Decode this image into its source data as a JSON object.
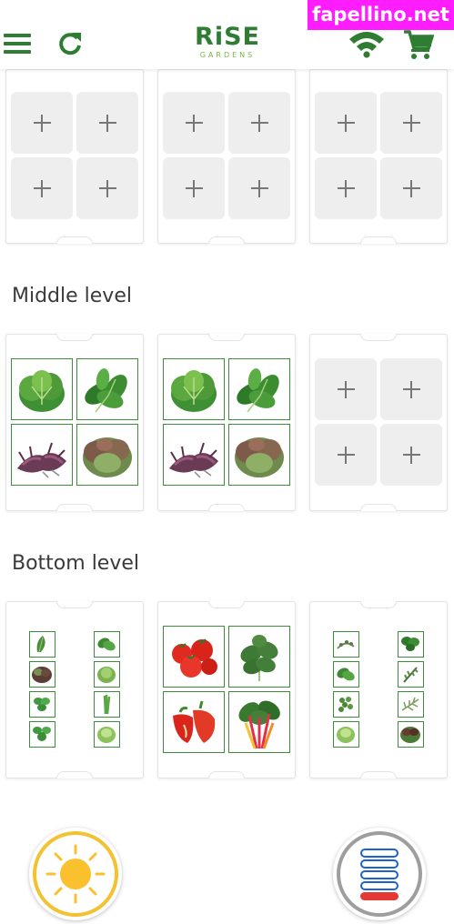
{
  "header": {
    "logo_main": "RiSE",
    "logo_sub": "GARDENS",
    "icons": [
      "menu-icon",
      "refresh-icon",
      "wifi-icon",
      "cart-icon"
    ],
    "brand_color": "#2e7d32"
  },
  "watermark": "fapellino.net",
  "levels": [
    {
      "label": "",
      "trays": [
        {
          "layout": "grid4",
          "cells": [
            "empty",
            "empty",
            "empty",
            "empty"
          ]
        },
        {
          "layout": "grid4",
          "cells": [
            "empty",
            "empty",
            "empty",
            "empty"
          ]
        },
        {
          "layout": "grid4",
          "cells": [
            "empty",
            "empty",
            "empty",
            "empty"
          ]
        }
      ]
    },
    {
      "label": "Middle level",
      "trays": [
        {
          "layout": "grid4",
          "cells": [
            "butter-lettuce",
            "spinach",
            "red-mustard",
            "red-leaf-lettuce"
          ]
        },
        {
          "layout": "grid4",
          "cells": [
            "butter-lettuce",
            "spinach",
            "red-mustard",
            "red-leaf-lettuce"
          ]
        },
        {
          "layout": "grid4",
          "cells": [
            "empty",
            "empty",
            "empty",
            "empty"
          ]
        }
      ]
    },
    {
      "label": "Bottom level",
      "trays": [
        {
          "layout": "mini8",
          "cells": [
            "arugula",
            "basil",
            "red-lettuce",
            "green-lettuce",
            "mint",
            "chive",
            "mint",
            "butterhead"
          ]
        },
        {
          "layout": "grid4",
          "cells": [
            "tomato",
            "kale",
            "red-pepper",
            "swiss-chard"
          ]
        },
        {
          "layout": "mini8",
          "cells": [
            "thyme",
            "parsley",
            "basil",
            "rosemary",
            "oregano",
            "dill",
            "lettuce",
            "red-lettuce"
          ]
        }
      ]
    }
  ],
  "footer": {
    "icons": [
      "sun-icon",
      "water-level-icon"
    ],
    "sun_color": "#fbc02d",
    "water_color": "#1e63c9",
    "water_alert_color": "#e53935"
  }
}
